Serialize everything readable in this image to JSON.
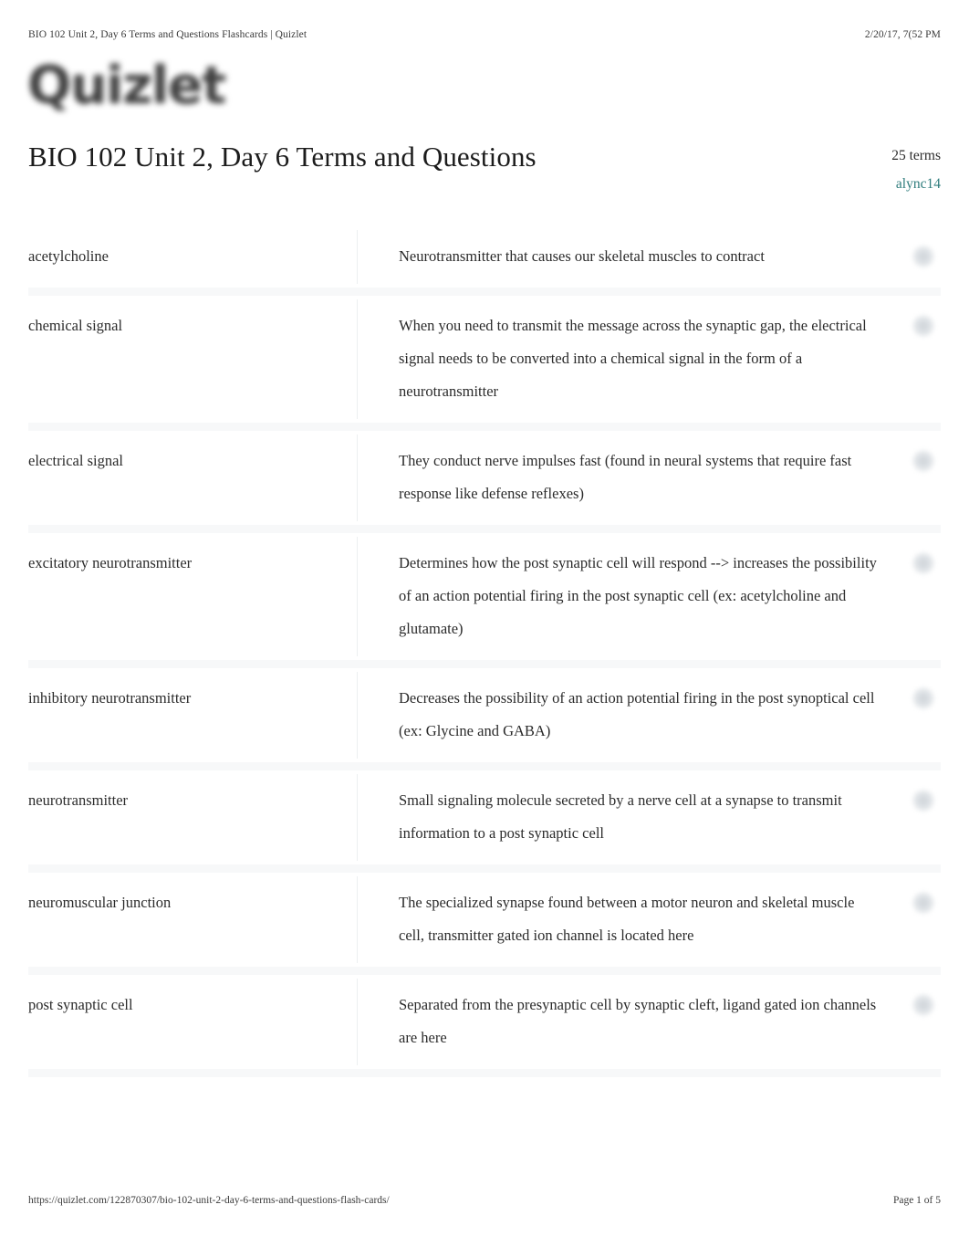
{
  "print_header": {
    "document_title": "BIO 102 Unit 2, Day 6 Terms and Questions Flashcards | Quizlet",
    "date": "2/20/17, 7(52 PM"
  },
  "brand": {
    "logo_text": "Quizlet"
  },
  "set": {
    "title": "BIO 102 Unit 2, Day 6 Terms and Questions",
    "term_count": "25 terms",
    "author": "alync14"
  },
  "colors": {
    "author_link": "#2e7c7c",
    "text": "#2b2b2b",
    "row_separator": "#f7f8f9",
    "column_divider": "#eceff1"
  },
  "icons": {
    "audio": "speaker-icon"
  },
  "terms": [
    {
      "term": "acetylcholine",
      "definition": "Neurotransmitter that causes our skeletal muscles to contract"
    },
    {
      "term": "chemical signal",
      "definition": "When you need to transmit the message across the synaptic gap, the electrical signal needs to be converted into a chemical signal in the form of a neurotransmitter"
    },
    {
      "term": "electrical signal",
      "definition": "They conduct nerve impulses fast (found in neural systems that require fast response like defense reflexes)"
    },
    {
      "term": "excitatory neurotransmitter",
      "definition": "Determines how the post synaptic cell will respond --> increases the possibility of an action potential firing in the post synaptic cell (ex: acetylcholine and glutamate)"
    },
    {
      "term": "inhibitory neurotransmitter",
      "definition": "Decreases the possibility of an action potential firing in the post synoptical cell (ex: Glycine and GABA)"
    },
    {
      "term": "neurotransmitter",
      "definition": "Small signaling molecule secreted by a nerve cell at a synapse to transmit information to a post synaptic cell"
    },
    {
      "term": "neuromuscular junction",
      "definition": "The specialized synapse found between a motor neuron and skeletal muscle cell, transmitter gated ion channel is located here"
    },
    {
      "term": "post synaptic cell",
      "definition": "Separated from the presynaptic cell by synaptic cleft, ligand gated ion channels are here"
    }
  ],
  "print_footer": {
    "url": "https://quizlet.com/122870307/bio-102-unit-2-day-6-terms-and-questions-flash-cards/",
    "page": "Page 1 of 5"
  }
}
